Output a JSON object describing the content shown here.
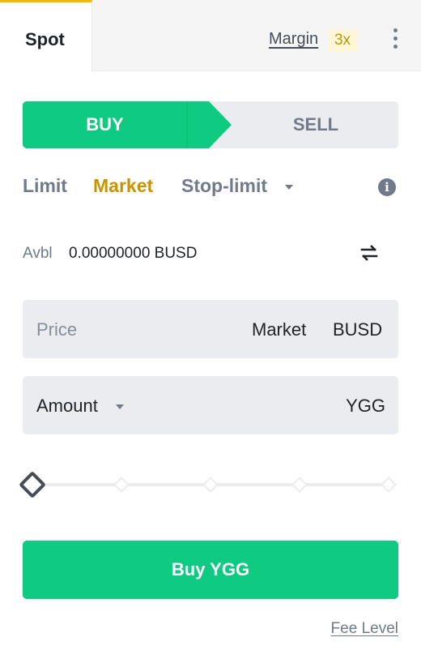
{
  "tabs": {
    "spot_label": "Spot",
    "margin_label": "Margin",
    "leverage_badge": "3x"
  },
  "side_toggle": {
    "buy_label": "BUY",
    "sell_label": "SELL"
  },
  "order_types": {
    "limit": "Limit",
    "market": "Market",
    "stop_limit": "Stop-limit",
    "active": "market"
  },
  "balance": {
    "label": "Avbl",
    "value": "0.00000000 BUSD"
  },
  "price_field": {
    "label": "Price",
    "value": "Market",
    "unit": "BUSD"
  },
  "amount_field": {
    "label": "Amount",
    "unit": "YGG"
  },
  "slider": {
    "value_percent": 0,
    "stops": [
      0,
      25,
      50,
      75,
      100
    ]
  },
  "submit": {
    "label": "Buy YGG"
  },
  "footer": {
    "fee_level_label": "Fee Level"
  },
  "colors": {
    "buy_green": "#0ecb81",
    "accent_gold": "#c99400",
    "muted_text": "#707a8a"
  }
}
